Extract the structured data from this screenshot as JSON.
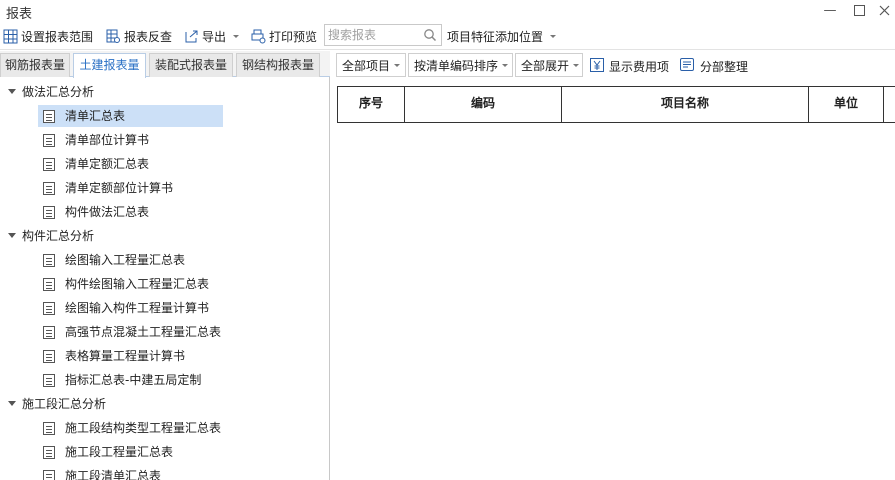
{
  "window": {
    "title": "报表"
  },
  "toolbar": {
    "set_range": "设置报表范围",
    "check_report": "报表反查",
    "export": "导出",
    "print_preview": "打印预览",
    "search_placeholder": "搜索报表",
    "feature_position": "项目特征添加位置"
  },
  "tabs": [
    {
      "label": "钢筋报表量",
      "active": false
    },
    {
      "label": "土建报表量",
      "active": true
    },
    {
      "label": "装配式报表量",
      "active": false
    },
    {
      "label": "钢结构报表量",
      "active": false
    }
  ],
  "tree": {
    "group1": {
      "label": "做法汇总分析",
      "items": [
        "清单汇总表",
        "清单部位计算书",
        "清单定额汇总表",
        "清单定额部位计算书",
        "构件做法汇总表"
      ]
    },
    "group2": {
      "label": "构件汇总分析",
      "items": [
        "绘图输入工程量汇总表",
        "构件绘图输入工程量汇总表",
        "绘图输入构件工程量计算书",
        "高强节点混凝土工程量汇总表",
        "表格算量工程量计算书",
        "指标汇总表-中建五局定制"
      ]
    },
    "group3": {
      "label": "施工段汇总分析",
      "items": [
        "施工段结构类型工程量汇总表",
        "施工段工程量汇总表",
        "施工段清单汇总表"
      ]
    },
    "selected": "清单汇总表"
  },
  "right_toolbar": {
    "all_items": "全部项目",
    "sort_by_code": "按清单编码排序",
    "expand_all": "全部展开",
    "show_cost": "显示费用项",
    "section_arrange": "分部整理"
  },
  "table": {
    "headers": [
      "序号",
      "编码",
      "项目名称",
      "单位"
    ]
  },
  "colors": {
    "accent": "#2a70c5",
    "selected_bg": "#cce0f7"
  }
}
